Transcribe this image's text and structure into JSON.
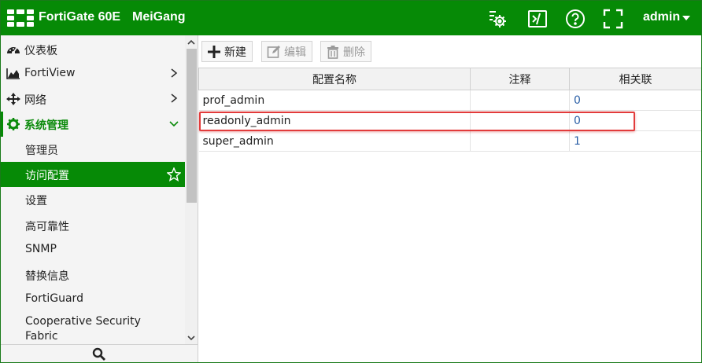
{
  "header": {
    "product": "FortiGate 60E",
    "hostname": "MeiGang",
    "user": "admin",
    "icons": [
      "settings-scan-icon",
      "cli-console-icon",
      "help-icon",
      "fullscreen-icon"
    ]
  },
  "sidebar": {
    "items": [
      {
        "label": "仪表板",
        "icon": "dashboard-icon"
      },
      {
        "label": "FortiView",
        "icon": "fortiview-icon"
      },
      {
        "label": "网络",
        "icon": "network-icon"
      },
      {
        "label": "系统管理",
        "icon": "gear-icon"
      },
      {
        "label": "管理员"
      },
      {
        "label": "访问配置"
      },
      {
        "label": "设置"
      },
      {
        "label": "高可靠性"
      },
      {
        "label": "SNMP"
      },
      {
        "label": "替换信息"
      },
      {
        "label": "FortiGuard"
      },
      {
        "label": "Cooperative Security Fabric"
      }
    ]
  },
  "toolbar": {
    "new_label": "新建",
    "edit_label": "编辑",
    "delete_label": "删除"
  },
  "table": {
    "columns": [
      "配置名称",
      "注释",
      "相关联"
    ],
    "rows": [
      {
        "name": "prof_admin",
        "comment": "",
        "refs": "0"
      },
      {
        "name": "readonly_admin",
        "comment": "",
        "refs": "0"
      },
      {
        "name": "super_admin",
        "comment": "",
        "refs": "1"
      }
    ]
  },
  "colors": {
    "brand_green": "#068a06",
    "link_blue": "#2a5fa6",
    "highlight_red": "#e23b3b"
  }
}
